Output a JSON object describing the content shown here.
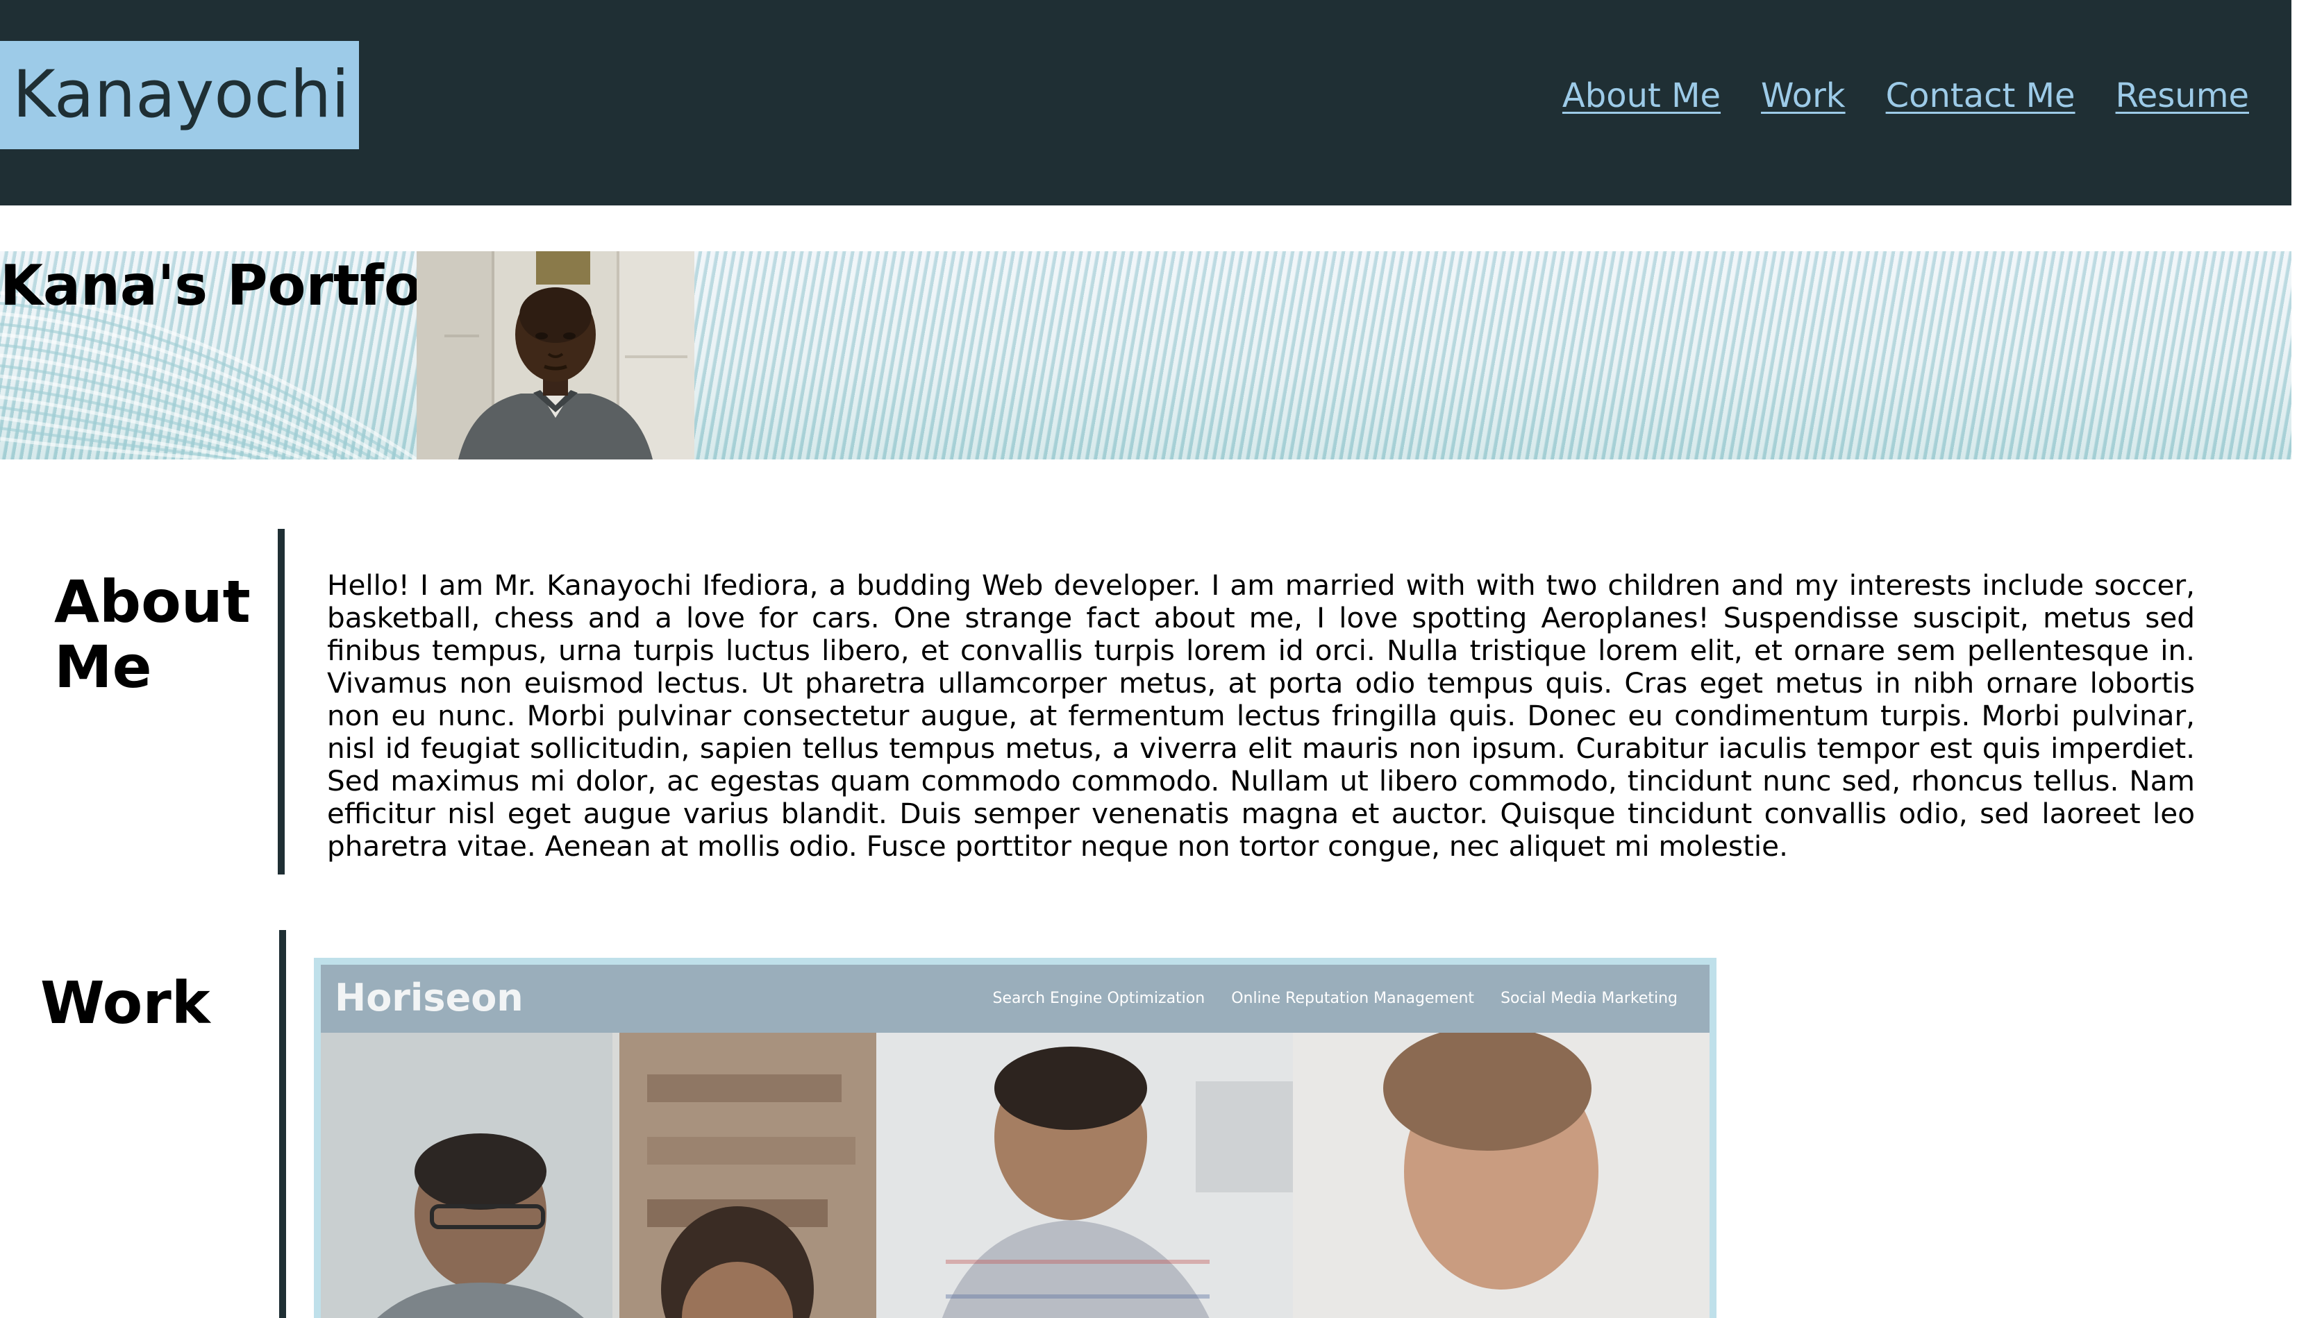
{
  "header": {
    "logo": "Kanayochi",
    "nav": [
      "About Me",
      "Work",
      "Contact Me",
      "Resume"
    ]
  },
  "hero": {
    "title": "Kana's Portfolio",
    "photo_icon": "profile-photo-icon"
  },
  "about": {
    "heading": "About Me",
    "text": "Hello! I am Mr. Kanayochi Ifediora, a budding Web developer. I am married with with two children and my interests include soccer, basketball, chess and a love for cars. One strange fact about me, I love spotting Aeroplanes! Suspendisse suscipit, metus sed finibus tempus, urna turpis luctus libero, et convallis turpis lorem id orci. Nulla tristique lorem elit, et ornare sem pellentesque in. Vivamus non euismod lectus. Ut pharetra ullamcorper metus, at porta odio tempus quis. Cras eget metus in nibh ornare lobortis non eu nunc. Morbi pulvinar consectetur augue, at fermentum lectus fringilla quis. Donec eu condimentum turpis. Morbi pulvinar, nisl id feugiat sollicitudin, sapien tellus tempus metus, a viverra elit mauris non ipsum. Curabitur iaculis tempor est quis imperdiet. Sed maximus mi dolor, ac egestas quam commodo commodo. Nullam ut libero commodo, tincidunt nunc sed, rhoncus tellus. Nam efficitur nisl eget augue varius blandit. Duis semper venenatis magna et auctor. Quisque tincidunt convallis odio, sed laoreet leo pharetra vitae. Aenean at mollis odio. Fusce porttitor neque non tortor congue, nec aliquet mi molestie."
  },
  "work": {
    "heading": "Work",
    "project": {
      "brand": "Horiseon",
      "nav": [
        "Search Engine Optimization",
        "Online Reputation Management",
        "Social Media Marketing"
      ]
    }
  },
  "colors": {
    "header_bg": "#1f2f34",
    "accent": "#9dcbe8",
    "divider": "#1f2f34",
    "project_header": "#9aaebb"
  }
}
